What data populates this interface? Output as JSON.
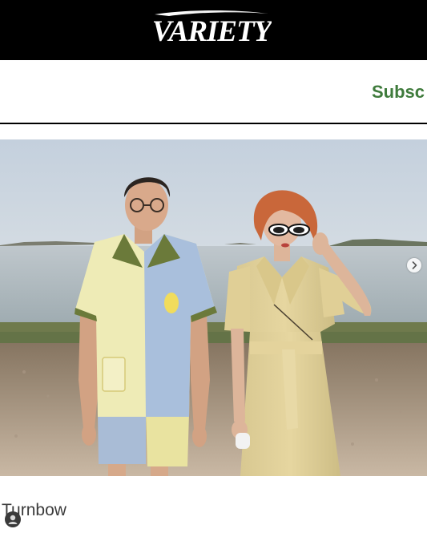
{
  "header": {
    "logo_text": "VARIETY",
    "subscribe_label": "Subsc"
  },
  "photo": {
    "carousel_next_icon": "chevron-right-icon"
  },
  "caption": {
    "author": "Turnbow",
    "avatar_icon": "user-avatar-icon"
  },
  "colors": {
    "masthead": "#000000",
    "subscribe": "#3f7b3c"
  }
}
